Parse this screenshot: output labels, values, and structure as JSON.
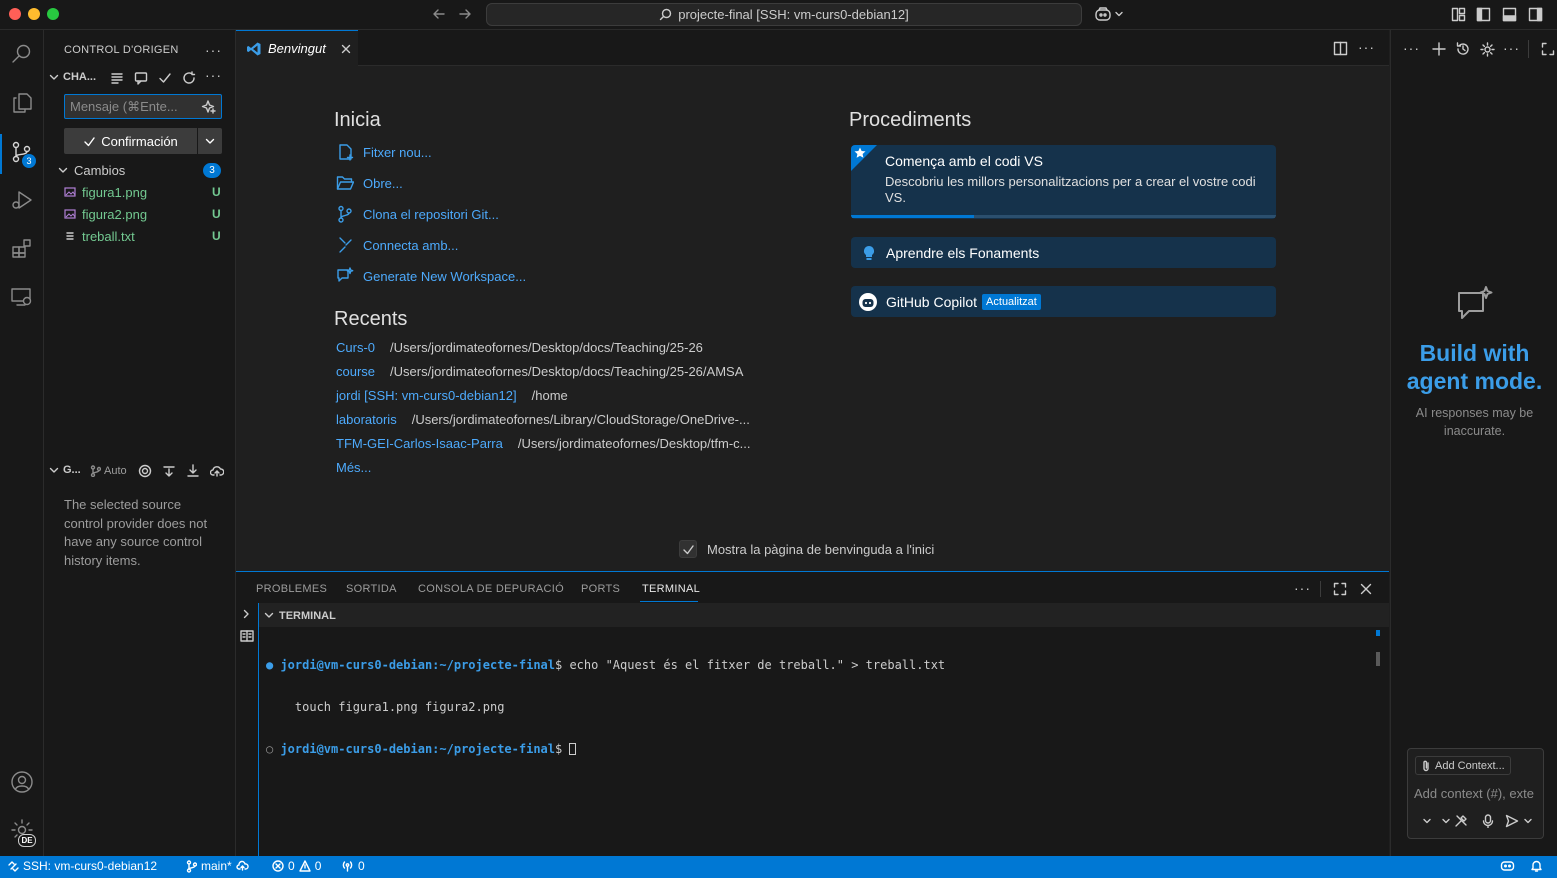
{
  "titlebar": {
    "command_center": "projecte-final [SSH: vm-curs0-debian12]"
  },
  "sidebar": {
    "title": "CONTROL D'ORIGEN",
    "changes_section": "CHA...",
    "commit_placeholder": "Mensaje (⌘Ente...",
    "commit_button": "Confirmación",
    "changes_group": "Cambios",
    "changes_count": "3",
    "files": [
      {
        "name": "figura1.png",
        "status": "U",
        "icon": "image-file-icon"
      },
      {
        "name": "figura2.png",
        "status": "U",
        "icon": "image-file-icon"
      },
      {
        "name": "treball.txt",
        "status": "U",
        "icon": "text-file-icon"
      }
    ],
    "graph_section": "G...",
    "graph_auto": "Auto",
    "graph_empty_message": "The selected source control provider does not have any source control history items.",
    "scm_badge": "3",
    "account_badge": "DE"
  },
  "editor": {
    "tab_label": "Benvingut",
    "start_heading": "Inicia",
    "start_items": [
      {
        "label": "Fitxer nou...",
        "icon": "new-file-icon"
      },
      {
        "label": "Obre...",
        "icon": "folder-open-icon"
      },
      {
        "label": "Clona el repositori Git...",
        "icon": "git-clone-icon"
      },
      {
        "label": "Connecta amb...",
        "icon": "remote-connect-icon"
      },
      {
        "label": "Generate New Workspace...",
        "icon": "sparkle-icon"
      }
    ],
    "recent_heading": "Recents",
    "recents": [
      {
        "name": "Curs-0",
        "path": "/Users/jordimateofornes/Desktop/docs/Teaching/25-26"
      },
      {
        "name": "course",
        "path": "/Users/jordimateofornes/Desktop/docs/Teaching/25-26/AMSA"
      },
      {
        "name": "jordi [SSH: vm-curs0-debian12]",
        "path": "/home"
      },
      {
        "name": "laboratoris",
        "path": "/Users/jordimateofornes/Library/CloudStorage/OneDrive-..."
      },
      {
        "name": "TFM-GEI-Carlos-Isaac-Parra",
        "path": "/Users/jordimateofornes/Desktop/tfm-c..."
      }
    ],
    "more_label": "Més...",
    "walkthrough_heading": "Procediments",
    "walkthrough_main_title": "Comença amb el codi VS",
    "walkthrough_main_desc": "Descobriu les millors personalitzacions per a crear el vostre codi VS.",
    "walkthrough_main_progress": 0.29,
    "walkthrough_fundamentals": "Aprendre els Fonaments",
    "walkthrough_copilot": "GitHub Copilot",
    "copilot_badge": "Actualitzat",
    "show_on_startup": "Mostra la pàgina de benvinguda a l'inici"
  },
  "panel": {
    "tabs": [
      "PROBLEMES",
      "SORTIDA",
      "CONSOLA DE DEPURACIÓ",
      "PORTS",
      "TERMINAL"
    ],
    "active_tab": "TERMINAL",
    "terminal_header": "TERMINAL",
    "lines": [
      {
        "user": "jordi@vm-curs0-debian",
        "path": ":~/projecte-final",
        "prompt": "$",
        "cmd": " echo \"Aquest és el fitxer de treball.\" > treball.txt"
      },
      {
        "cont": "    touch figura1.png figura2.png"
      },
      {
        "user": "jordi@vm-curs0-debian",
        "path": ":~/projecte-final",
        "prompt": "$",
        "cmd": " "
      }
    ]
  },
  "chat": {
    "title_line1": "Build with",
    "title_line2": "agent mode.",
    "disclaimer": "AI responses may be inaccurate.",
    "add_context": "Add Context...",
    "input_placeholder": "Add context (#), exte"
  },
  "status": {
    "remote": "SSH: vm-curs0-debian12",
    "branch": "main*",
    "errors": "0",
    "warnings": "0",
    "ports": "0"
  },
  "colors": {
    "accent": "#0078d4",
    "link": "#4daafc",
    "git_untracked": "#73c991"
  }
}
